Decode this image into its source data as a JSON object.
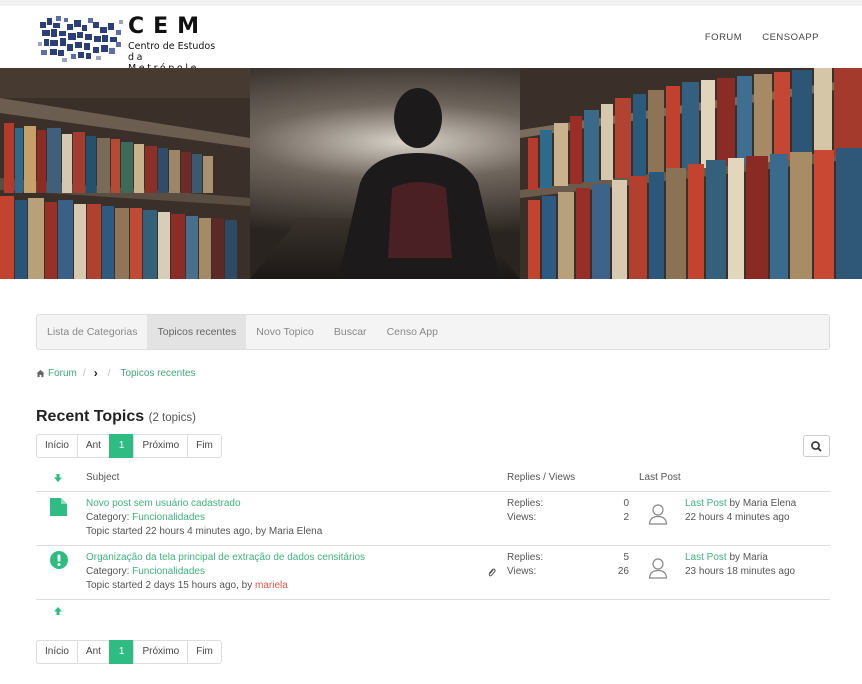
{
  "header": {
    "logo_big": "CEM",
    "logo_line1": "Centro de Estudos",
    "logo_line2": "da Metrópole",
    "nav": [
      "FORUM",
      "CENSOAPP"
    ]
  },
  "menu": [
    "Lista de Categorias",
    "Topicos recentes",
    "Novo Topico",
    "Buscar",
    "Censo App"
  ],
  "breadcrumb": {
    "home": "Forum",
    "sep": "/",
    "current": "Topicos recentes"
  },
  "page": {
    "title": "Recent Topics",
    "count": "(2 topics)"
  },
  "pagination": [
    "Início",
    "Ant",
    "1",
    "Próximo",
    "Fim"
  ],
  "table": {
    "col_subject": "Subject",
    "col_replies_views": "Replies / Views",
    "col_last_post": "Last Post",
    "rows": [
      {
        "title": "Novo post sem usuário cadastrado",
        "category_label": "Category:",
        "category": "Funcionalidades",
        "started": "Topic started 22 hours 4 minutes ago, by",
        "author": "Maria Elena",
        "replies_label": "Replies:",
        "views_label": "Views:",
        "replies": "0",
        "views": "2",
        "last_post_label": "Last Post",
        "last_by": "by",
        "last_author": "Maria Elena",
        "last_time": "22 hours 4 minutes ago",
        "icon": "file-icon"
      },
      {
        "title": "Organização da tela principal de extração de dados censitários",
        "category_label": "Category:",
        "category": "Funcionalidades",
        "started": "Topic started 2 days 15 hours ago, by",
        "author": "mariela",
        "replies_label": "Replies:",
        "views_label": "Views:",
        "replies": "5",
        "views": "26",
        "last_post_label": "Last Post",
        "last_by": "by",
        "last_author": "Maria",
        "last_time": "23 hours 18 minutes ago",
        "icon": "exclamation-circle-icon"
      }
    ]
  },
  "colors": {
    "accent": "#2ebc82",
    "link": "#3fb37f",
    "author_red": "#e05a4a"
  }
}
